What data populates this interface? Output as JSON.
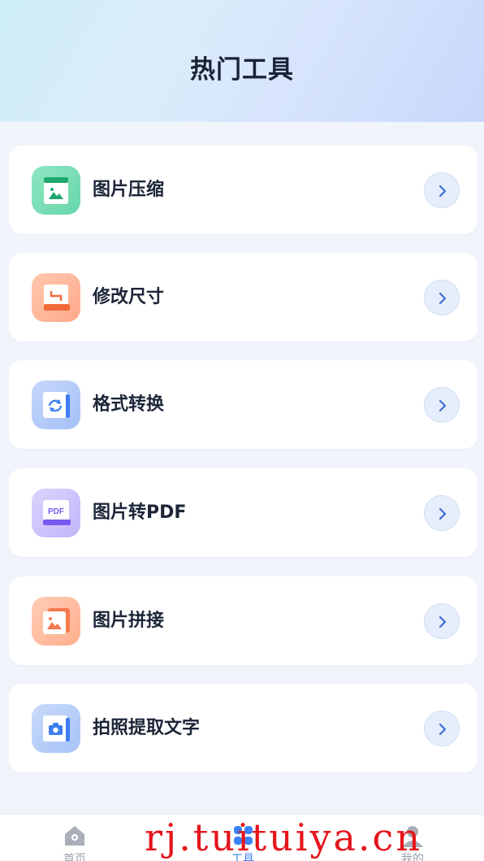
{
  "header": {
    "title": "热门工具"
  },
  "tools": [
    {
      "label": "图片压缩",
      "icon": "image-compress-icon",
      "color": "#6fdcb0"
    },
    {
      "label": "修改尺寸",
      "icon": "resize-icon",
      "color": "#ffb08e"
    },
    {
      "label": "格式转换",
      "icon": "format-convert-icon",
      "color": "#a9c3f7"
    },
    {
      "label": "图片转PDF",
      "icon": "pdf-icon",
      "color": "#c6b9fb",
      "badge": "PDF"
    },
    {
      "label": "图片拼接",
      "icon": "image-stitch-icon",
      "color": "#ffb394"
    },
    {
      "label": "拍照提取文字",
      "icon": "camera-ocr-icon",
      "color": "#aac4f6"
    }
  ],
  "tabbar": {
    "items": [
      {
        "label": "首页",
        "icon": "home-icon"
      },
      {
        "label": "工具",
        "icon": "grid-icon",
        "active": true
      },
      {
        "label": "我的",
        "icon": "user-icon"
      }
    ]
  },
  "watermark": "rj.tuituiya.cn",
  "colors": {
    "accent": "#3b82f6",
    "title": "#1a2336",
    "watermark": "#e5141b"
  }
}
